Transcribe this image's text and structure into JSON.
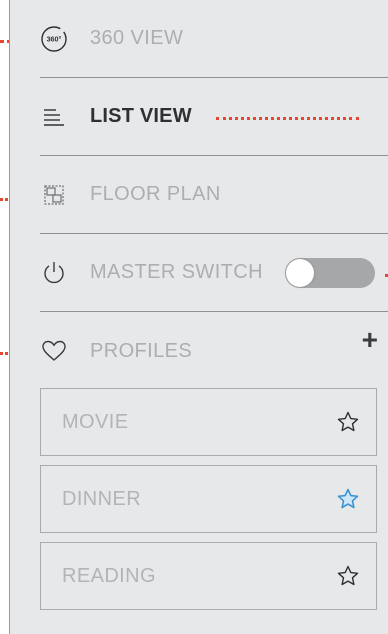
{
  "menu": {
    "view360": {
      "label": "360 VIEW",
      "icon": "360-icon"
    },
    "list_view": {
      "label": "LIST VIEW",
      "icon": "list-icon"
    },
    "floor_plan": {
      "label": "FLOOR PLAN",
      "icon": "floor-plan-icon"
    },
    "master_switch": {
      "label": "MASTER SWITCH",
      "icon": "power-icon",
      "toggle_on": false
    },
    "profiles": {
      "label": "PROFILES",
      "icon": "heart-icon",
      "add_label": "+"
    }
  },
  "profiles": [
    {
      "label": "MOVIE",
      "starred": false
    },
    {
      "label": "DINNER",
      "starred": true
    },
    {
      "label": "READING",
      "starred": false
    }
  ],
  "icon_360_text": "360°",
  "colors": {
    "panel_bg": "#e7e8e9",
    "leader": "#e8472f",
    "active_text": "#2f3034",
    "inactive_text": "#adaeaf",
    "star_active": "#3b94d1",
    "toggle_track": "#a6a7a8"
  }
}
